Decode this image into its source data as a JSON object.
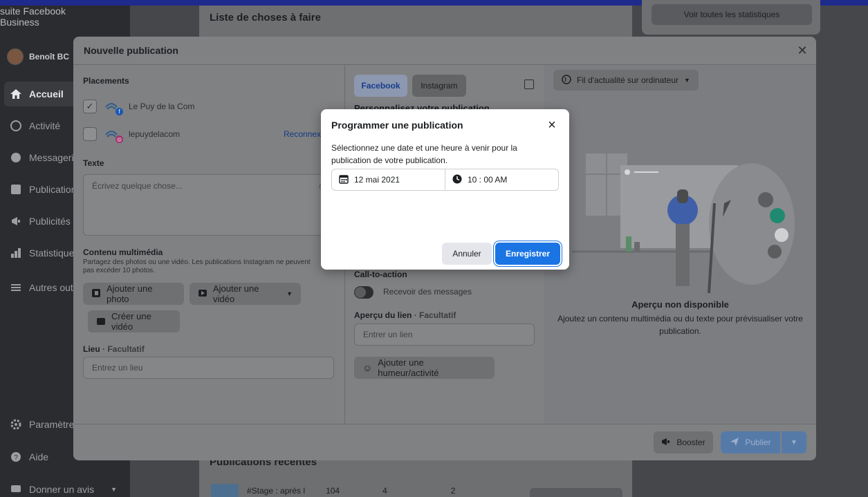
{
  "app": {
    "brand": "suite Facebook Business",
    "user": "Benoît BC"
  },
  "sidebar": {
    "items": [
      {
        "label": "Accueil",
        "icon": "home-icon"
      },
      {
        "label": "Activité",
        "icon": "activity-icon"
      },
      {
        "label": "Messagerie",
        "icon": "messenger-icon"
      },
      {
        "label": "Publications",
        "icon": "posts-icon"
      },
      {
        "label": "Publicités",
        "icon": "megaphone-icon"
      },
      {
        "label": "Statistiques",
        "icon": "chart-icon"
      },
      {
        "label": "Autres outils",
        "icon": "menu-icon"
      }
    ],
    "bottom": [
      {
        "label": "Paramètres",
        "icon": "gear-icon"
      },
      {
        "label": "Aide",
        "icon": "help-icon"
      },
      {
        "label": "Donner un avis",
        "icon": "feedback-icon"
      }
    ]
  },
  "background": {
    "todo_title": "Liste de choses à faire",
    "stats_button": "Voir toutes les statistiques",
    "recent_title": "Publications récentes",
    "recent_row": {
      "caption": "#Stage : après l",
      "v1": "104",
      "v2": "4",
      "v3": "2"
    }
  },
  "composer": {
    "title": "Nouvelle publication",
    "placements_label": "Placements",
    "placements": [
      {
        "name": "Le Puy de la Com",
        "checked": true,
        "network": "facebook"
      },
      {
        "name": "lepuydelacom",
        "checked": false,
        "network": "instagram"
      }
    ],
    "reconnect": "Reconnex",
    "text_label": "Texte",
    "text_placeholder": "Écrivez quelque chose...",
    "media_label": "Contenu multimédia",
    "media_sub": "Partagez des photos ou une vidéo. Les publications Instagram ne peuvent pas excéder 10 photos.",
    "add_photo": "Ajouter une photo",
    "add_video": "Ajouter une vidéo",
    "create_video": "Créer une vidéo",
    "location_label": "Lieu",
    "location_optional": "· Facultatif",
    "location_placeholder": "Entrez un lieu",
    "tabs": [
      "Facebook",
      "Instagram"
    ],
    "customize_title": "Personnalisez votre publication",
    "cta_label": "Call-to-action",
    "cta_toggle": "Recevoir des messages",
    "link_label": "Aperçu du lien",
    "link_optional": "· Facultatif",
    "link_placeholder": "Entrer un lien",
    "mood_button": "Ajouter une humeur/activité",
    "preview_dropdown": "Fil d'actualité sur ordinateur",
    "preview_title": "Aperçu non disponible",
    "preview_sub": "Ajoutez un contenu multimédia ou du texte pour prévisualiser votre publication.",
    "boost": "Booster",
    "publish": "Publier"
  },
  "dialog": {
    "title": "Programmer une publication",
    "description": "Sélectionnez une date et une heure à venir pour la publication de votre publication.",
    "date": "12 mai 2021",
    "time": "10 : 00 AM",
    "cancel": "Annuler",
    "save": "Enregistrer"
  },
  "colors": {
    "accent": "#1b74e4",
    "overlay": "#808183"
  }
}
